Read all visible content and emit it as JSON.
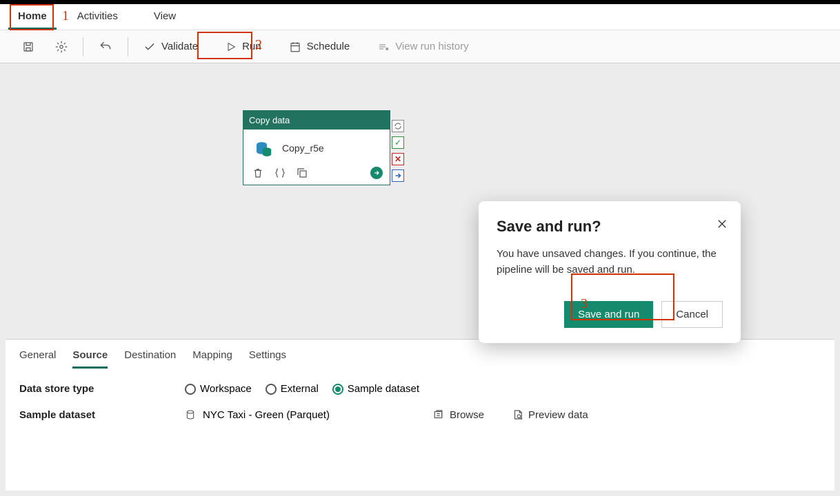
{
  "ribbon": {
    "tabs": [
      "Home",
      "Activities",
      "View"
    ],
    "active": "Home"
  },
  "toolbar": {
    "validate": "Validate",
    "run": "Run",
    "schedule": "Schedule",
    "view_history": "View run history"
  },
  "activity": {
    "type_label": "Copy data",
    "name": "Copy_r5e"
  },
  "properties": {
    "tabs": [
      "General",
      "Source",
      "Destination",
      "Mapping",
      "Settings"
    ],
    "active": "Source",
    "data_store_label": "Data store type",
    "radios": [
      "Workspace",
      "External",
      "Sample dataset"
    ],
    "radio_selected": "Sample dataset",
    "sample_label": "Sample dataset",
    "sample_value": "NYC Taxi - Green (Parquet)",
    "browse": "Browse",
    "preview": "Preview data"
  },
  "dialog": {
    "title": "Save and run?",
    "body": "You have unsaved changes. If you continue, the pipeline will be saved and run.",
    "primary": "Save and run",
    "secondary": "Cancel"
  },
  "annotations": {
    "one": "1",
    "two": "2",
    "three": "3"
  }
}
